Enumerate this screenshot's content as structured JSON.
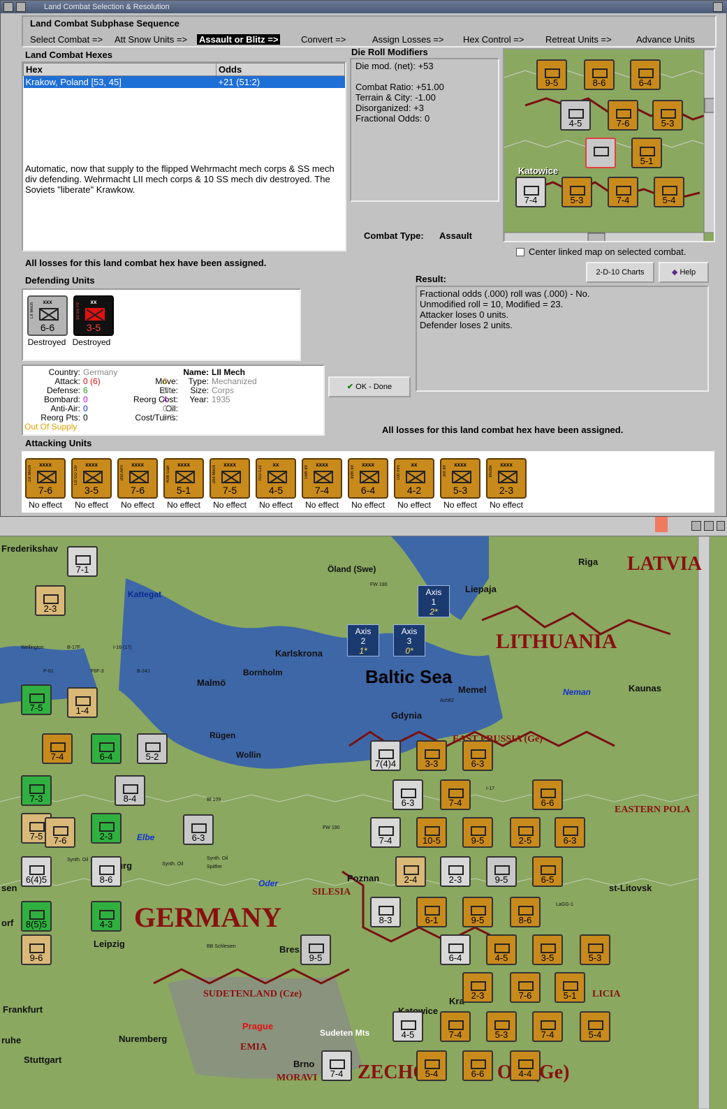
{
  "window": {
    "title": "Land Combat Selection & Resolution"
  },
  "sequence": {
    "heading": "Land Combat Subphase Sequence",
    "steps": [
      "Select Combat =>",
      "Att Snow Units =>",
      "Assault or Blitz =>",
      "Convert =>",
      "Assign Losses =>",
      "Hex Control =>",
      "Retreat Units =>",
      "Advance Units"
    ]
  },
  "hexes": {
    "heading": "Land Combat Hexes",
    "columns": [
      "Hex",
      "Odds"
    ],
    "rows": [
      {
        "hex": "Krakow, Poland [53, 45]",
        "odds": "+21 (51:2)"
      }
    ],
    "note": "Automatic, now that supply to the flipped Wehrmacht mech corps & SS mech div defending.  Wehrmacht LII mech corps & 10 SS mech div destroyed.  The Soviets \"liberate\" Krawkow."
  },
  "modifiers": {
    "heading": "Die Roll Modifiers",
    "lines": [
      "Die mod. (net): +53",
      "",
      "Combat Ratio: +51.00",
      "Terrain & City: -1.00",
      "Disorganized: +3",
      "Fractional Odds: 0"
    ],
    "combat_type_label": "Combat Type:",
    "combat_type": "Assault"
  },
  "minimap": {
    "center_label": "Center linked map on selected combat.",
    "city": "Katowice",
    "city2": "Kr"
  },
  "buttons": {
    "charts": "2-D-10 Charts",
    "help": "Help",
    "ok": "OK - Done"
  },
  "status": {
    "losses_msg": "All losses for this land combat hex have been assigned.",
    "losses_msg2": "All losses for this land combat hex have been assigned."
  },
  "defending": {
    "heading": "Defending Units",
    "units": [
      {
        "size": "xxx",
        "name": "LII Mech",
        "strength": "6-6",
        "result": "Destroyed",
        "style": "grey"
      },
      {
        "size": "xx",
        "name": "10 SS Pz",
        "strength": "3-5",
        "result": "Destroyed",
        "style": "red"
      }
    ]
  },
  "result": {
    "heading": "Result:",
    "lines": [
      "Fractional odds (.000) roll was (.000)  - No.",
      "Unmodified roll = 10, Modified = 23.",
      "Attacker loses 0 units.",
      "Defender loses 2 units."
    ]
  },
  "unit_info": {
    "country_label": "Country:",
    "country": "Germany",
    "attack_label": "Attack:",
    "attack": "0",
    "attack_orig": "(6)",
    "defense_label": "Defense:",
    "defense": "6",
    "bombard_label": "Bombard:",
    "bombard": "0",
    "antiair_label": "Anti-Air:",
    "antiair": "0",
    "reorg_label": "Reorg Pts:",
    "reorg": "0",
    "supply": "Out Of Supply",
    "move_label": "Move:",
    "move": "6",
    "elite_label": "Elite:",
    "elite": "No",
    "reorgcost_label": "Reorg Cost:",
    "reorgcost": "4",
    "oil_label": "Oil:",
    "oil": "0.2",
    "cost_label": "Cost/Turns:",
    "cost": "5/3",
    "name_label": "Name:",
    "name": "LII Mech",
    "type_label": "Type:",
    "type": "Mechanized",
    "size_label": "Size:",
    "size": "Corps",
    "year_label": "Year:",
    "year": "1935"
  },
  "attacking": {
    "heading": "Attacking Units",
    "units": [
      {
        "size": "xxxx",
        "name": "1st Mech",
        "strength": "7-6",
        "result": "No effect"
      },
      {
        "size": "xxxx",
        "name": "1st GD Div",
        "strength": "3-5",
        "result": "No effect"
      },
      {
        "size": "xxxx",
        "name": "2nd Arm",
        "strength": "7-6",
        "result": "No effect"
      },
      {
        "size": "xxxx",
        "name": "40th Garr",
        "strength": "5-1",
        "result": "No effect"
      },
      {
        "size": "xxxx",
        "name": "2nd Mech",
        "strength": "7-5",
        "result": "No effect"
      },
      {
        "size": "xx",
        "name": "ISU-122",
        "strength": "4-5",
        "result": "No effect"
      },
      {
        "size": "xxxx",
        "name": "16th Inf",
        "strength": "7-4",
        "result": "No effect"
      },
      {
        "size": "xxxx",
        "name": "39th Inf",
        "strength": "6-4",
        "result": "No effect"
      },
      {
        "size": "xx",
        "name": "100 mm",
        "strength": "4-2",
        "result": "No effect"
      },
      {
        "size": "xxxx",
        "name": "3rd Inf",
        "strength": "5-3",
        "result": "No effect"
      },
      {
        "size": "xxxx",
        "name": "Irkutsk",
        "strength": "2-3",
        "result": "No effect"
      }
    ]
  },
  "map": {
    "sea": "Baltic Sea",
    "countries": [
      "GERMANY",
      "LITHUANIA",
      "LATVIA",
      "SILESIA",
      "EAST PRUSSIA (Ge)",
      "EASTERN POLA",
      "SUDETENLAND (Cze)",
      "ZECHO",
      "OK (Ge)",
      "LICIA",
      "MORAVI",
      "EMIA"
    ],
    "places": [
      "Frederikshav",
      "Kattegat",
      "Öland (Swe)",
      "Liepaja",
      "Riga",
      "Karlskrona",
      "Malmö",
      "Bornholm",
      "Memel",
      "Kaunas",
      "Neman",
      "Gdynia",
      "Rügen",
      "Wollin",
      "Elbe",
      "Oder",
      "Poznan",
      "Leipzig",
      "Bres",
      "Frankfurt",
      "Nuremberg",
      "Prague",
      "Sudeten Mts",
      "Katowice",
      "Stuttgart",
      "Brno",
      "Kra",
      "st-Litovsk",
      "deburg",
      "sen",
      "orf",
      "ruhe",
      "Synth. Oil",
      "Synth. Oil",
      "Synth. Oil",
      "BB Schlesien",
      "Bf 109",
      "FW 190",
      "FW 190",
      "Spitfire",
      "P-61",
      "F6F-3",
      "B-24J",
      "Wellington",
      "B-17F",
      "I-16 (17)",
      "LaGG-1",
      "I-17",
      "Ach82"
    ],
    "axis_boxes": [
      {
        "label": "Axis",
        "num": "1",
        "sub": "2*"
      },
      {
        "label": "Axis",
        "num": "2",
        "sub": "1*"
      },
      {
        "label": "Axis",
        "num": "3",
        "sub": "0*"
      }
    ],
    "units": [
      "7-1",
      "2-3",
      "7-5",
      "1-4",
      "7-4",
      "6-4",
      "5-2",
      "7-3",
      "8-4",
      "7-5",
      "2-3",
      "7-6",
      "8-6",
      "6-3",
      "6(4)5",
      "8(5)5",
      "4-3",
      "9-6",
      "9-5",
      "7(4)4",
      "3-3",
      "6-3",
      "6-3",
      "7-4",
      "6-6",
      "7-4",
      "10-5",
      "9-5",
      "2-5",
      "6-3",
      "2-4",
      "2-3",
      "9-5",
      "6-5",
      "8-3",
      "6-1",
      "9-5",
      "8-6",
      "6-4",
      "4-5",
      "3-5",
      "5-3",
      "2-3",
      "7-6",
      "5-1",
      "4-5",
      "7-4",
      "5-3",
      "7-4",
      "5-4",
      "7-4",
      "5-4",
      "6-6",
      "4-4"
    ]
  }
}
